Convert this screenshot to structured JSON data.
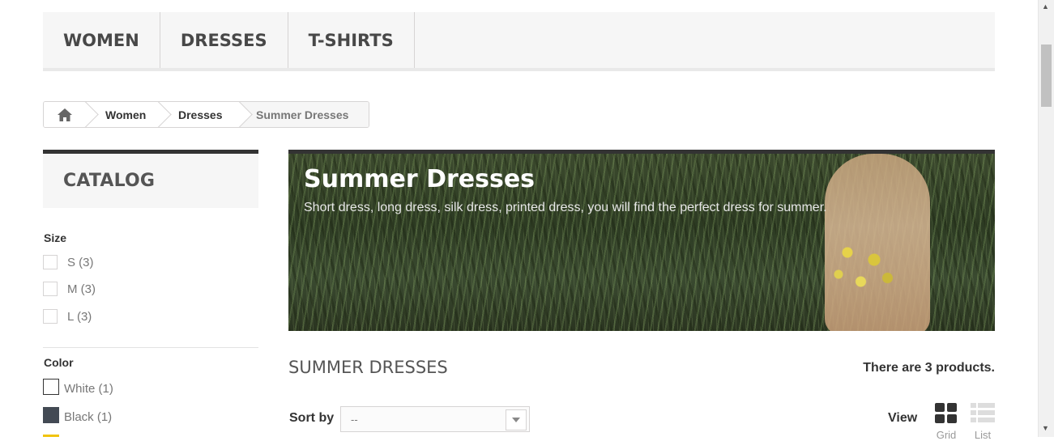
{
  "topmenu": {
    "items": [
      {
        "label": "WOMEN"
      },
      {
        "label": "DRESSES"
      },
      {
        "label": "T-SHIRTS"
      }
    ]
  },
  "breadcrumb": {
    "home_icon": "home-icon",
    "items": [
      "Women",
      "Dresses"
    ],
    "current": "Summer Dresses"
  },
  "sidebar": {
    "catalog_title": "CATALOG",
    "size": {
      "heading": "Size",
      "options": [
        {
          "label": "S (3)"
        },
        {
          "label": "M (3)"
        },
        {
          "label": "L (3)"
        }
      ]
    },
    "color": {
      "heading": "Color",
      "options": [
        {
          "label": "White (1)",
          "swatch": "#ffffff"
        },
        {
          "label": "Black (1)",
          "swatch": "#434a54"
        }
      ]
    }
  },
  "banner": {
    "title": "Summer Dresses",
    "description": "Short dress, long dress, silk dress, printed dress, you will find the perfect dress for summer."
  },
  "content": {
    "heading": "SUMMER DRESSES",
    "product_count": "There are 3 products.",
    "sort": {
      "label": "Sort by",
      "value": "--"
    },
    "view": {
      "label": "View",
      "grid_label": "Grid",
      "list_label": "List",
      "active": "grid"
    }
  },
  "colors": {
    "accent": "#333333",
    "menu_bg": "#f6f6f6",
    "border": "#d6d4d4"
  }
}
